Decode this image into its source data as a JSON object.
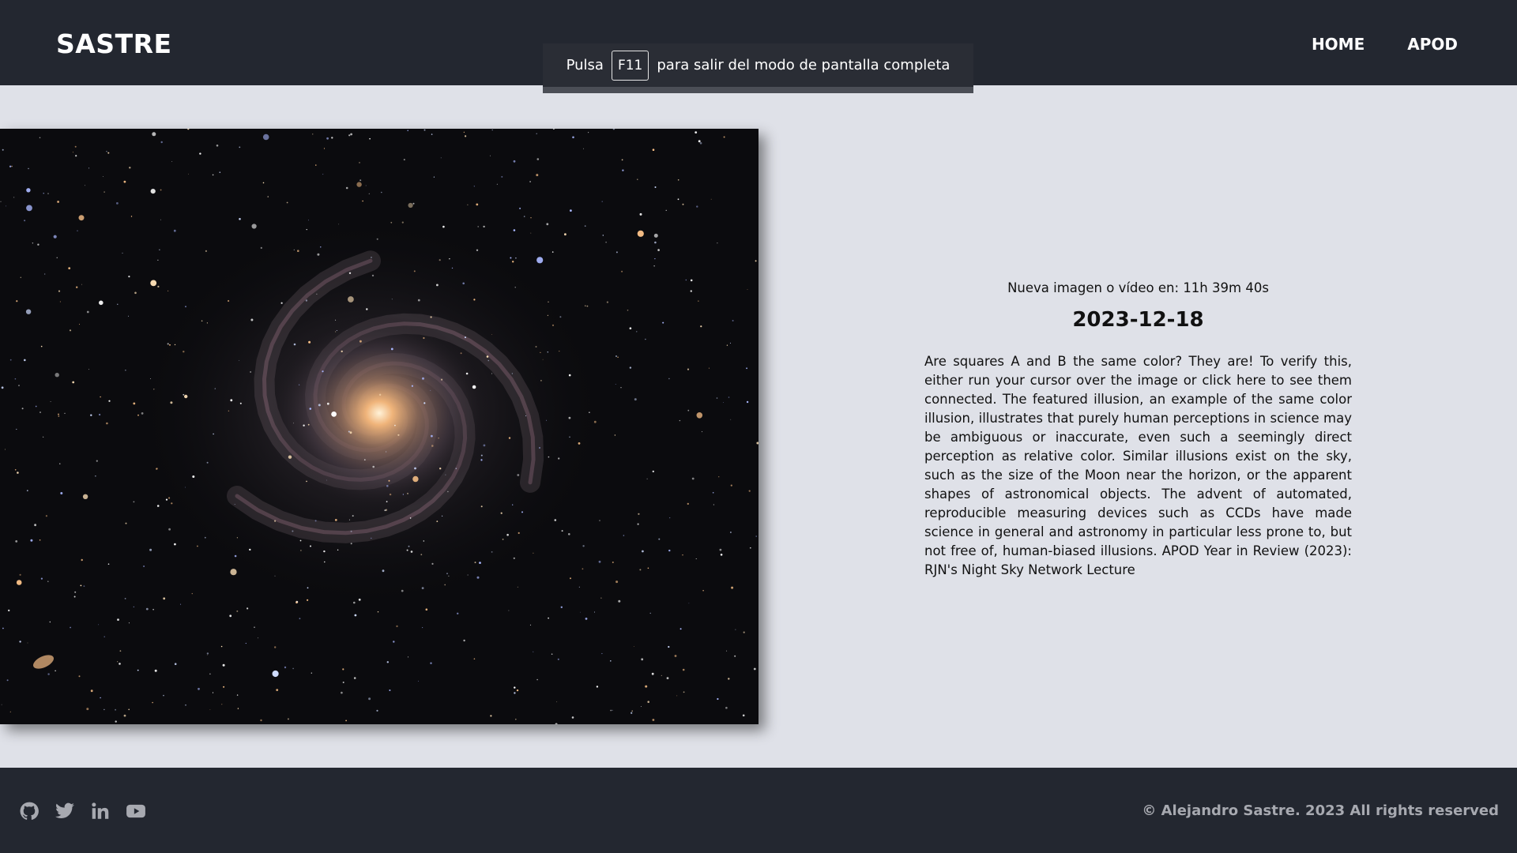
{
  "header": {
    "logo": "SASTRE",
    "nav": [
      {
        "label": "HOME"
      },
      {
        "label": "APOD"
      }
    ]
  },
  "fullscreen_notice": {
    "before": "Pulsa",
    "key": "F11",
    "after": "para salir del modo de pantalla completa"
  },
  "apod": {
    "image_icon": "spiral-galaxy-photo",
    "countdown": "Nueva imagen o vídeo en: 11h 39m 40s",
    "date": "2023-12-18",
    "explanation": "Are squares A and B the same color? They are! To verify this, either run your cursor over the image or click here to see them connected. The featured illusion, an example of the same color illusion, illustrates that purely human perceptions in science may be ambiguous or inaccurate, even such a seemingly direct perception as relative color. Similar illusions exist on the sky, such as the size of the Moon near the horizon, or the apparent shapes of astronomical objects. The advent of automated, reproducible measuring devices such as CCDs have made science in general and astronomy in particular less prone to, but not free of, human-biased illusions. APOD Year in Review (2023): RJN's Night Sky Network Lecture"
  },
  "footer": {
    "social_icons": [
      "github-icon",
      "twitter-icon",
      "linkedin-icon",
      "youtube-icon"
    ],
    "copyright": "© Alejandro Sastre. 2023 All rights reserved"
  },
  "colors": {
    "header_bg": "#232730",
    "page_bg": "#dfe1e8",
    "footer_text": "#a7a9b0"
  }
}
